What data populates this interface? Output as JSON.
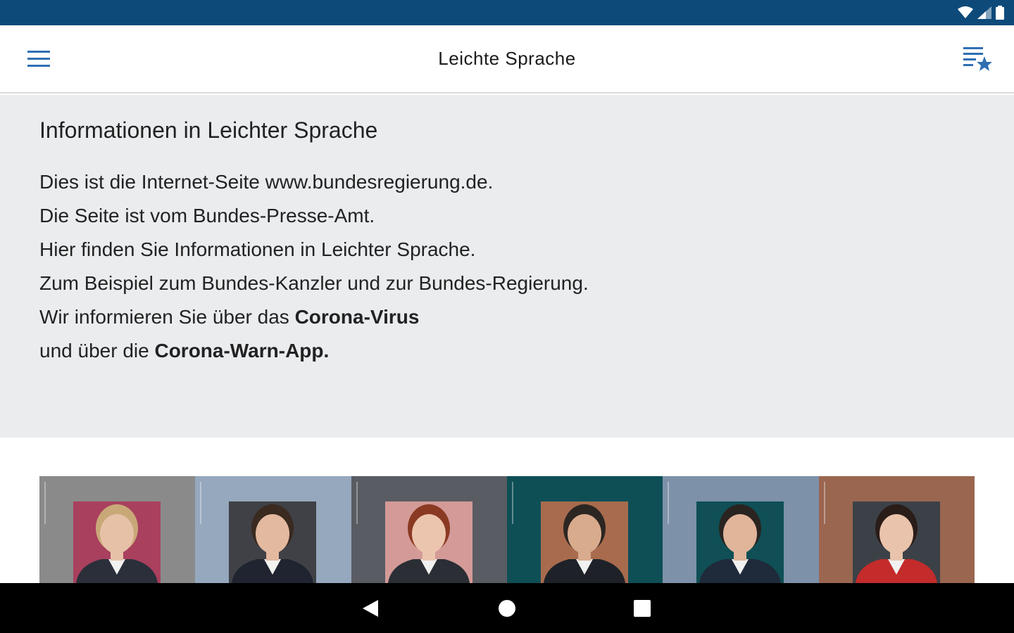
{
  "app_bar": {
    "title": "Leichte Sprache",
    "menu_icon": "hamburger-menu-icon",
    "favorites_icon": "playlist-star-icon",
    "accent": "#2f6fb3"
  },
  "status_bar": {
    "color": "#0d4a7a"
  },
  "intro": {
    "heading": "Informationen in Leichter Sprache",
    "lines": [
      {
        "before": "Dies ist die Internet-Seite www.bundesregierung.de.",
        "bold": "",
        "after": ""
      },
      {
        "before": "Die Seite ist vom Bundes-Presse-Amt.",
        "bold": "",
        "after": ""
      },
      {
        "before": "Hier finden Sie Informationen in Leichter Sprache.",
        "bold": "",
        "after": ""
      },
      {
        "before": "Zum Beispiel zum Bundes-Kanzler und zur Bundes-Regierung.",
        "bold": "",
        "after": ""
      },
      {
        "before": "Wir informieren Sie über das ",
        "bold": "Corona-Virus",
        "after": ""
      },
      {
        "before": "und über die ",
        "bold": "Corona-Warn-App",
        "after": "."
      }
    ],
    "background": "#eaecee"
  },
  "gallery": {
    "tiles": [
      {
        "bg": "#8a8a8a",
        "inner": "#a8405e",
        "suit": "#2a2f3a",
        "hair": "#c9a878",
        "skin": "#e6c1a8"
      },
      {
        "bg": "#95a8bd",
        "inner": "#3f4146",
        "suit": "#1f2430",
        "hair": "#3a2a20",
        "skin": "#e3b9a0"
      },
      {
        "bg": "#595c63",
        "inner": "#d49a98",
        "suit": "#2b2e35",
        "hair": "#8a3a22",
        "skin": "#ecc5ae"
      },
      {
        "bg": "#0e4f56",
        "inner": "#a86b4d",
        "suit": "#1e2228",
        "hair": "#2c2622",
        "skin": "#d9ab8d"
      },
      {
        "bg": "#7d91a8",
        "inner": "#0f4f55",
        "suit": "#1f2a3a",
        "hair": "#2a2420",
        "skin": "#e0b59a"
      },
      {
        "bg": "#9a6650",
        "inner": "#3c4148",
        "suit": "#c42b2b",
        "hair": "#2a1c18",
        "skin": "#e9c3ab"
      }
    ]
  },
  "nav_bar": {
    "back_icon": "back-triangle-icon",
    "home_icon": "home-circle-icon",
    "recents_icon": "recents-square-icon"
  }
}
